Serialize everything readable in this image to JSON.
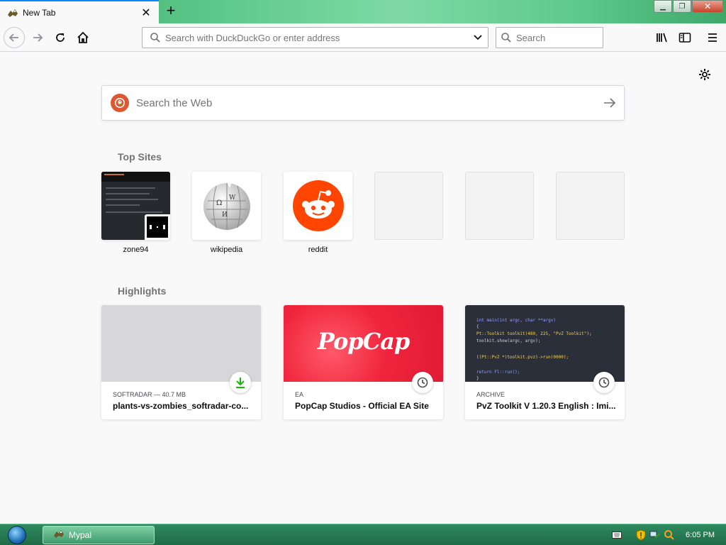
{
  "tab": {
    "title": "New Tab",
    "favicon": "mypal-icon"
  },
  "urlbar": {
    "placeholder": "Search with DuckDuckGo or enter address",
    "value": ""
  },
  "searchbar": {
    "placeholder": "Search"
  },
  "websearch": {
    "placeholder": "Search the Web"
  },
  "topsites": {
    "title": "Top Sites",
    "tiles": [
      {
        "label": "zone94"
      },
      {
        "label": "wikipedia"
      },
      {
        "label": "reddit"
      },
      {
        "label": ""
      },
      {
        "label": ""
      },
      {
        "label": ""
      }
    ]
  },
  "highlights": {
    "title": "Highlights",
    "cards": [
      {
        "meta": "SOFTRADAR — 40.7 MB",
        "title": "plants-vs-zombies_softradar-co...",
        "badge": "download-icon"
      },
      {
        "meta": "EA",
        "title": "PopCap Studios - Official EA Site",
        "badge": "clock-icon",
        "logo_text": "PopCap"
      },
      {
        "meta": "ARCHIVE",
        "title": "PvZ Toolkit V 1.20.3 English : Imi...",
        "badge": "clock-icon",
        "code": [
          "int main(int argc, char **argv)",
          "{",
          "    Pt::Toolkit toolkit(480, 225, \"PvZ Toolkit\");",
          "    toolkit.show(argc, argv);",
          "",
          "    ((Pt::PvZ *)toolkit.pvz)->run(0000);",
          "",
          "    return Fl::run();",
          "}"
        ]
      }
    ]
  },
  "taskbar": {
    "app_label": "Mypal",
    "clock": "6:05 PM"
  },
  "colors": {
    "accent": "#0a84ff",
    "titlebar_green": "#5cc98a",
    "reddit": "#ff4500",
    "popcap": "#f0253d",
    "duckduckgo": "#de5833",
    "download_green": "#12bc00"
  }
}
